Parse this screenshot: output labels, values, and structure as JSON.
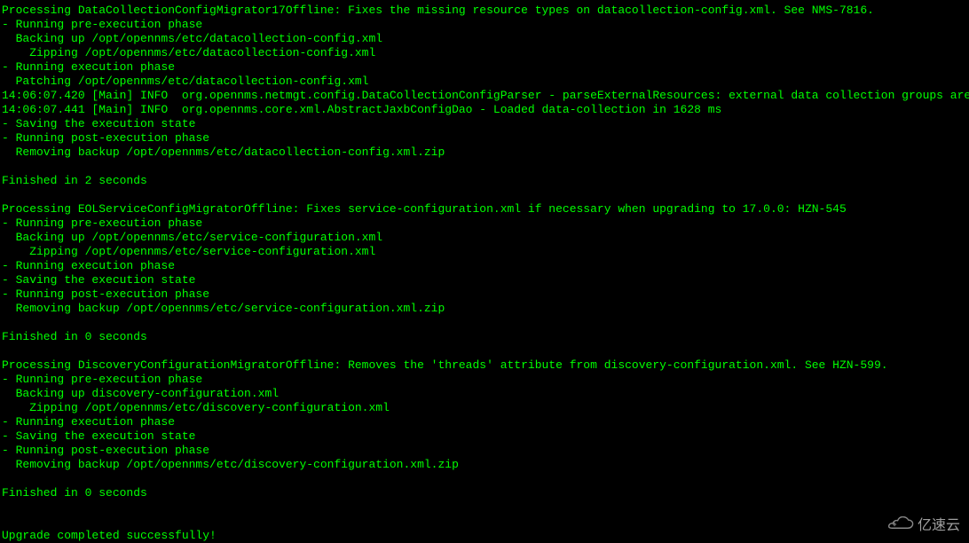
{
  "terminal": {
    "lines": [
      "Processing DataCollectionConfigMigrator17Offline: Fixes the missing resource types on datacollection-config.xml. See NMS-7816.",
      "- Running pre-execution phase",
      "  Backing up /opt/opennms/etc/datacollection-config.xml",
      "    Zipping /opt/opennms/etc/datacollection-config.xml",
      "- Running execution phase",
      "  Patching /opt/opennms/etc/datacollection-config.xml",
      "14:06:07.420 [Main] INFO  org.opennms.netmgt.config.DataCollectionConfigParser - parseExternalResources: external data collection groups are already parsed",
      "14:06:07.441 [Main] INFO  org.opennms.core.xml.AbstractJaxbConfigDao - Loaded data-collection in 1628 ms",
      "- Saving the execution state",
      "- Running post-execution phase",
      "  Removing backup /opt/opennms/etc/datacollection-config.xml.zip",
      "",
      "Finished in 2 seconds",
      "",
      "Processing EOLServiceConfigMigratorOffline: Fixes service-configuration.xml if necessary when upgrading to 17.0.0: HZN-545",
      "- Running pre-execution phase",
      "  Backing up /opt/opennms/etc/service-configuration.xml",
      "    Zipping /opt/opennms/etc/service-configuration.xml",
      "- Running execution phase",
      "- Saving the execution state",
      "- Running post-execution phase",
      "  Removing backup /opt/opennms/etc/service-configuration.xml.zip",
      "",
      "Finished in 0 seconds",
      "",
      "Processing DiscoveryConfigurationMigratorOffline: Removes the 'threads' attribute from discovery-configuration.xml. See HZN-599.",
      "- Running pre-execution phase",
      "  Backing up discovery-configuration.xml",
      "    Zipping /opt/opennms/etc/discovery-configuration.xml",
      "- Running execution phase",
      "- Saving the execution state",
      "- Running post-execution phase",
      "  Removing backup /opt/opennms/etc/discovery-configuration.xml.zip",
      "",
      "Finished in 0 seconds",
      "",
      "",
      "Upgrade completed successfully!"
    ]
  },
  "watermark": {
    "text": "亿速云"
  }
}
